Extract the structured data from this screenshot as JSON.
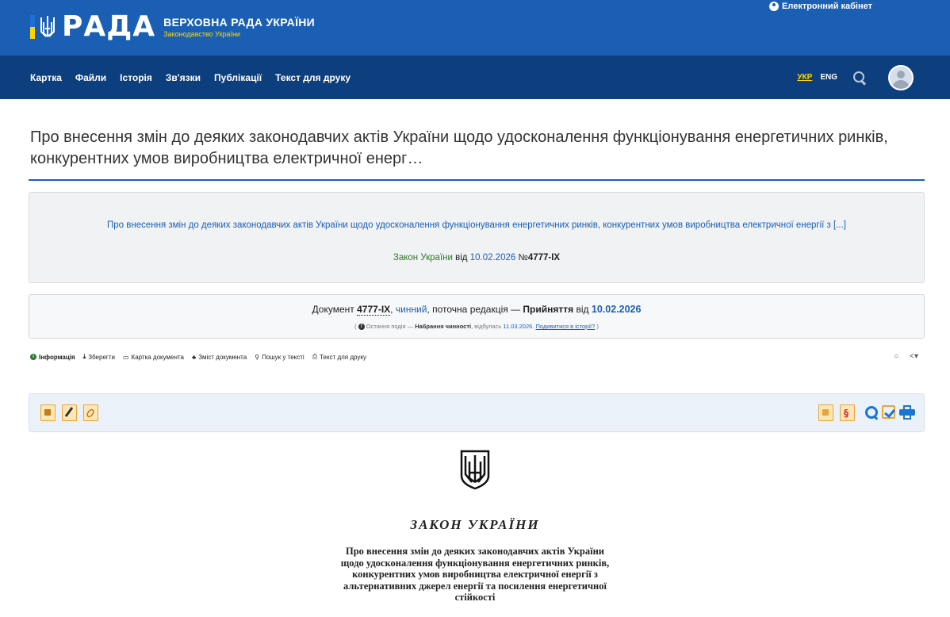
{
  "header": {
    "logo_word": "РАДА",
    "logo_title": "ВЕРХОВНА РАДА УКРАЇНИ",
    "logo_subtitle": "Законодавство України",
    "cabinet_label": "Електронний кабінет"
  },
  "nav": {
    "items": [
      "Картка",
      "Файли",
      "Історія",
      "Зв'язки",
      "Публікації",
      "Текст для друку"
    ],
    "lang_ukr": "УКР",
    "lang_eng": "ENG"
  },
  "page": {
    "title": "Про внесення змін до деяких законодавчих актів України щодо удосконалення функціонування енергетичних ринків, конкурентних умов виробництва електричної енерг…"
  },
  "summary": {
    "link_text": "Про внесення змін до деяких законодавчих актів України щодо удосконалення функціонування енергетичних ринків, конкурентних умов виробництва електричної енергії з [...]",
    "type": "Закон України",
    "from_label": "від",
    "date": "10.02.2026",
    "number_label": "№",
    "number": "4777-IX"
  },
  "docstatus": {
    "doc_label": "Документ",
    "number": "4777-IX",
    "status": "чинний",
    "edition_text": ", поточна редакція —",
    "adoption": "Прийняття",
    "from_label": "від",
    "date": "10.02.2026",
    "last_event_label": "Остання подія —",
    "last_event": "Набрання чинності",
    "happened_label": ", відбулась",
    "event_date": "11.03.2026.",
    "history_link": "Подивитися в історії?"
  },
  "toolbar": {
    "info": "Інформація",
    "save": "Зберегти",
    "card": "Картка документа",
    "contents": "Зміст документа",
    "search": "Пошук у тексті",
    "print": "Текст для друку"
  },
  "law": {
    "heading": "ЗАКОН УКРАЇНИ",
    "title_lines": [
      "Про внесення змін до деяких законодавчих актів України",
      "щодо удосконалення функціонування енергетичних ринків,",
      "конкурентних умов виробництва електричної енергії з",
      "альтернативних джерел енергії та посилення енергетичної",
      "стійкості"
    ]
  },
  "colors": {
    "header_blue": "#1a5fb4",
    "nav_dark_blue": "#0d3f7f",
    "accent_yellow": "#ffd500",
    "link_blue": "#1a5fb4",
    "green": "#2c7a2c"
  }
}
